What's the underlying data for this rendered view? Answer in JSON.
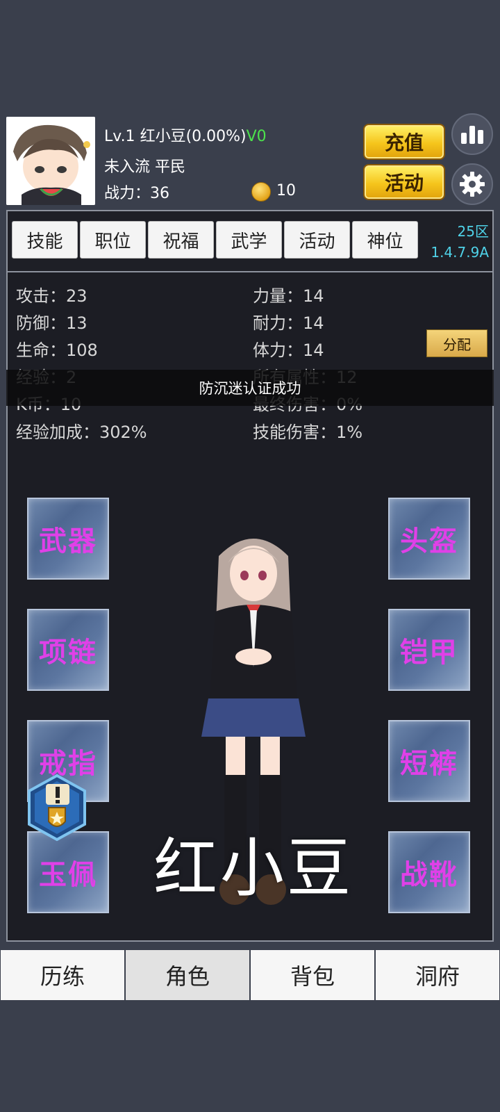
{
  "header": {
    "level": "Lv.1",
    "name_progress": "红小豆(0.00%)",
    "vip": "V0",
    "rank_title": "未入流 平民",
    "power_label": "战力：36",
    "coins": "10",
    "recharge_label": "充值",
    "event_label": "活动"
  },
  "tabs": [
    "技能",
    "职位",
    "祝福",
    "武学",
    "活动",
    "神位"
  ],
  "server": {
    "zone": "25区",
    "version": "1.4.7.9A"
  },
  "stats": {
    "attack": "攻击：23",
    "strength": "力量：14",
    "defense": "防御：13",
    "endurance": "耐力：14",
    "hp": "生命：108",
    "stamina": "体力：14",
    "exp": "经验：2",
    "all_attr": "所有属性：12",
    "kcoin": "K币：10",
    "final_dmg": "最终伤害：0%",
    "exp_bonus": "经验加成：302%",
    "skill_dmg": "技能伤害：1%"
  },
  "allocate_label": "分配",
  "toast": "防沉迷认证成功",
  "slots": {
    "weapon": "武器",
    "helmet": "头盔",
    "necklace": "项链",
    "armor": "铠甲",
    "ring": "戒指",
    "shorts": "短裤",
    "jade": "玉佩",
    "boots": "战靴"
  },
  "character_name": "红小豆",
  "nav": [
    "历练",
    "角色",
    "背包",
    "洞府"
  ],
  "colors": {
    "vip": "#4ce24c",
    "server": "#4fd2e8",
    "slot_text": "#e040e8",
    "gold_button": "#f5c51c"
  },
  "icons": {
    "rank": "bar-chart-icon",
    "settings": "gear-icon",
    "coin": "coin-icon",
    "quest": "quest-shield-icon"
  }
}
